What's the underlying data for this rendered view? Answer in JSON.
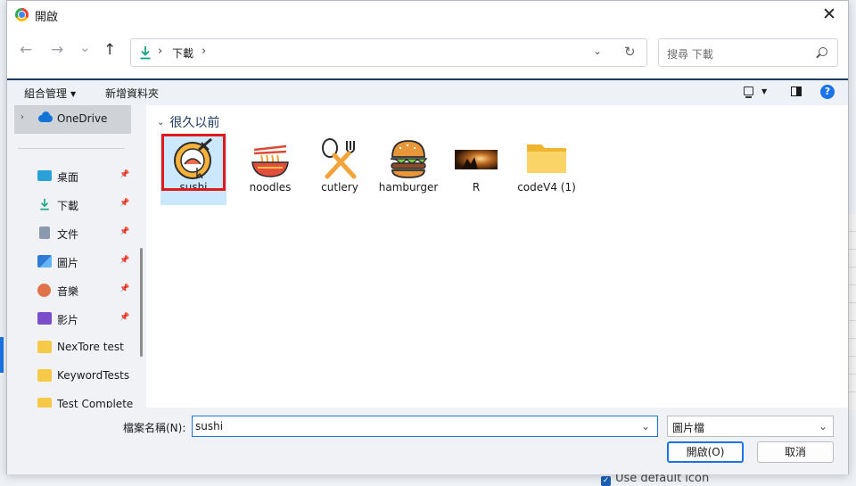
{
  "dialog": {
    "title": "開啟",
    "close_glyph": "✕"
  },
  "nav": {
    "back_glyph": "←",
    "forward_glyph": "→",
    "history_glyph": "⌄",
    "up_glyph": "↑",
    "path": [
      "下載"
    ],
    "separator": "›",
    "address_dropdown_glyph": "⌄",
    "refresh_glyph": "↻",
    "search_placeholder": "搜尋 下載"
  },
  "toolbar": {
    "organize_label": "組合管理",
    "organize_caret": "▼",
    "new_folder_label": "新增資料夾",
    "view_caret": "▼",
    "help_glyph": "?"
  },
  "sidebar": {
    "onedrive": {
      "expand_glyph": "›",
      "label": "OneDrive"
    },
    "pin_glyph": "📌",
    "items": [
      {
        "label": "桌面",
        "icon": "desktop-icon",
        "pinned": true
      },
      {
        "label": "下載",
        "icon": "download-icon",
        "pinned": true
      },
      {
        "label": "文件",
        "icon": "document-icon",
        "pinned": true
      },
      {
        "label": "圖片",
        "icon": "pictures-icon",
        "pinned": true
      },
      {
        "label": "音樂",
        "icon": "music-icon",
        "pinned": true
      },
      {
        "label": "影片",
        "icon": "videos-icon",
        "pinned": true
      },
      {
        "label": "NexTore test",
        "icon": "folder-icon",
        "pinned": false
      },
      {
        "label": "KeywordTests",
        "icon": "folder-icon",
        "pinned": false
      },
      {
        "label": "Test Complete",
        "icon": "folder-icon",
        "pinned": false
      }
    ]
  },
  "content": {
    "group_chevron": "⌄",
    "group_label": "很久以前",
    "files": [
      {
        "name": "sushi",
        "icon": "sushi-icon",
        "selected": true
      },
      {
        "name": "noodles",
        "icon": "noodles-icon",
        "selected": false
      },
      {
        "name": "cutlery",
        "icon": "cutlery-icon",
        "selected": false
      },
      {
        "name": "hamburger",
        "icon": "hamburger-icon",
        "selected": false
      },
      {
        "name": "R",
        "icon": "image-thumbnail",
        "selected": false
      },
      {
        "name": "codeV4 (1)",
        "icon": "folder-icon",
        "selected": false
      }
    ]
  },
  "bottom": {
    "filename_label": "檔案名稱(N):",
    "filename_value": "sushi",
    "filename_dropdown_glyph": "⌄",
    "filetype_value": "圖片檔",
    "filetype_dropdown_glyph": "⌄",
    "open_label": "開啟(O)",
    "cancel_label": "取消"
  },
  "background": {
    "checkbox_glyph": "✓",
    "checkbox_label": "Use default icon"
  },
  "colors": {
    "accent": "#1a73e8",
    "selection": "#cce8ff",
    "highlight_ring": "#e01a1a",
    "folder": "#f7c948"
  }
}
